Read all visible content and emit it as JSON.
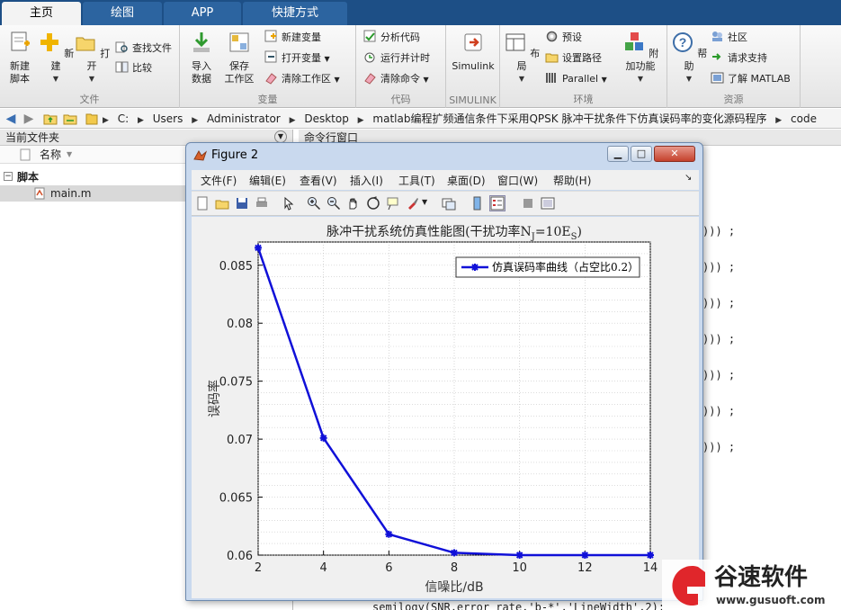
{
  "ribbon_tabs": [
    "主页",
    "绘图",
    "APP",
    "快捷方式"
  ],
  "ribbon": {
    "file_group": {
      "label": "文件",
      "new_script": "新建\n脚本",
      "new": "新建",
      "open": "打开",
      "find_files": "查找文件",
      "compare": "比较"
    },
    "variable_group": {
      "label": "变量",
      "import_data": "导入\n数据",
      "save_workspace": "保存\n工作区",
      "new_variable": "新建变量",
      "open_variable": "打开变量",
      "clear_workspace": "清除工作区"
    },
    "code_group": {
      "label": "代码",
      "analyze_code": "分析代码",
      "run_and_time": "运行并计时",
      "clear_commands": "清除命令"
    },
    "simulink_group": {
      "label": "SIMULINK",
      "simulink": "Simulink"
    },
    "environment_group": {
      "label": "环境",
      "layout": "布局",
      "preferences": "预设",
      "set_path": "设置路径",
      "parallel": "Parallel",
      "addons": "附加功能"
    },
    "resources_group": {
      "label": "资源",
      "help": "帮助",
      "community": "社区",
      "request_support": "请求支持",
      "learn_matlab": "了解 MATLAB"
    }
  },
  "address_bar": {
    "path": [
      "C:",
      "Users",
      "Administrator",
      "Desktop",
      "matlab编程扩频通信条件下采用QPSK 脉冲干扰条件下仿真误码率的变化源码程序",
      "code"
    ]
  },
  "left_panel": {
    "title": "当前文件夹",
    "column_name": "名称",
    "group": "脚本",
    "file": "main.m"
  },
  "command_window": {
    "title": "命令行窗口",
    "line_fragment": "))) ;",
    "bottom_fragment": "semilogy(SNR,error_rate,'b-*','LineWidth',2);"
  },
  "figure_window": {
    "title": "Figure 2",
    "menu": [
      "文件(F)",
      "编辑(E)",
      "查看(V)",
      "插入(I)",
      "工具(T)",
      "桌面(D)",
      "窗口(W)",
      "帮助(H)"
    ]
  },
  "chart_data": {
    "type": "line",
    "title": "脉冲干扰系统仿真性能图(干扰功率N",
    "title_sub1": "J",
    "title_mid": "=10E",
    "title_sub2": "S",
    "title_end": ")",
    "xlabel": "信噪比/dB",
    "ylabel": "误码率",
    "x": [
      2,
      4,
      6,
      8,
      10,
      12,
      14
    ],
    "y": [
      0.0865,
      0.0701,
      0.0618,
      0.0602,
      0.06,
      0.06,
      0.06
    ],
    "xlim": [
      2,
      14
    ],
    "ylim": [
      0.06,
      0.087
    ],
    "xticks": [
      "2",
      "4",
      "6",
      "8",
      "10",
      "12",
      "14"
    ],
    "yticks": [
      "0.06",
      "0.065",
      "0.07",
      "0.075",
      "0.08",
      "0.085"
    ],
    "ytick_values": [
      0.06,
      0.065,
      0.07,
      0.075,
      0.08,
      0.085
    ],
    "grid": true,
    "legend": "仿真误码率曲线（占空比0.2）",
    "legend_position": "top-right",
    "series_color": "#1010d8"
  },
  "watermark": {
    "brand": "谷速软件",
    "url": "www.gusuoft.com"
  },
  "colors": {
    "ribbon_blue": "#1d4f86",
    "accent_red": "#e0262b"
  }
}
